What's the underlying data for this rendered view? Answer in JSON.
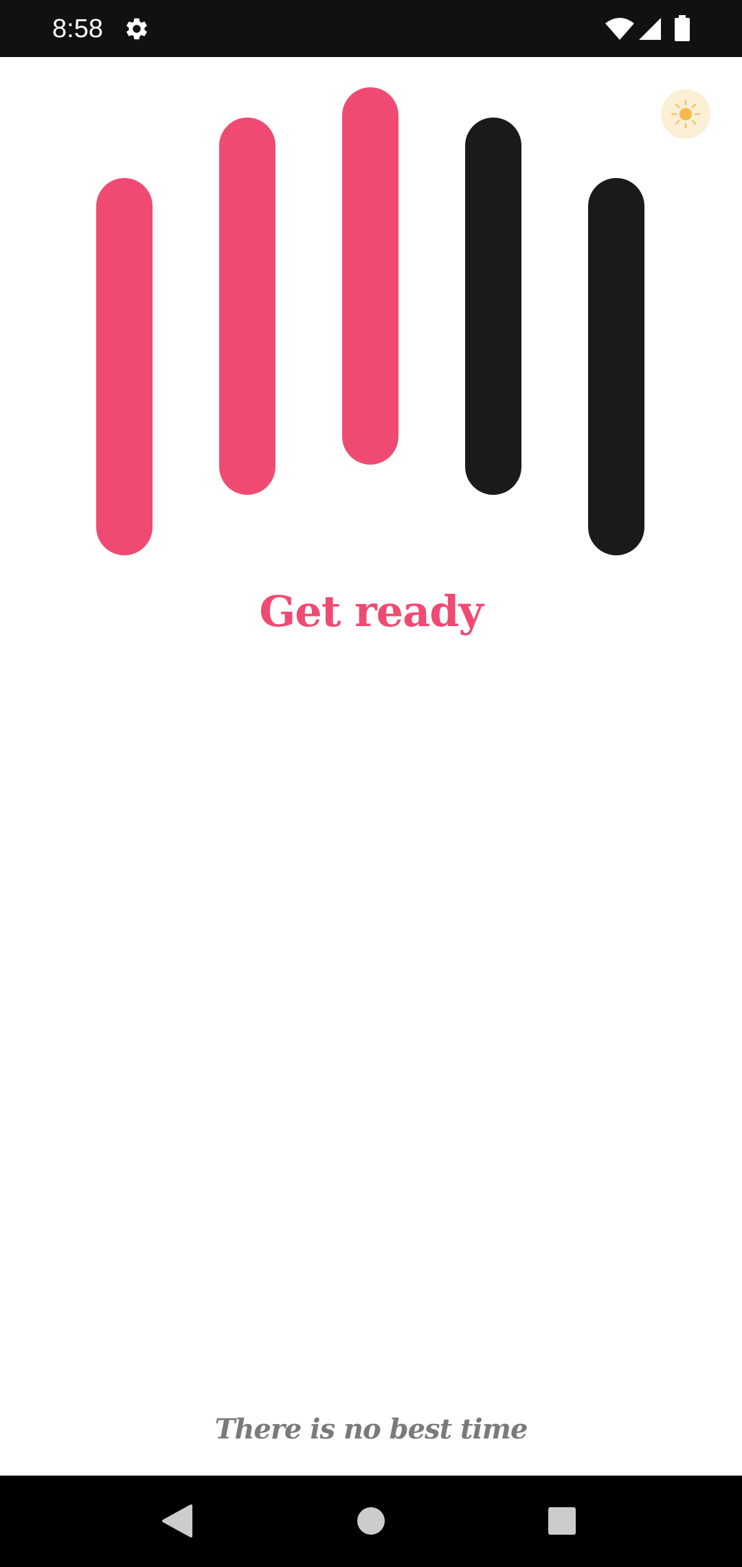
{
  "status_bar": {
    "time": "8:58",
    "icons": [
      "gear-icon",
      "wifi-icon",
      "signal-icon",
      "battery-icon"
    ]
  },
  "theme_toggle": {
    "icon": "sun-icon",
    "background": "#fbefd6",
    "icon_color": "#f6b94c"
  },
  "breathing_bars": {
    "colors": {
      "active": "#ef4b72",
      "inactive": "#1a1a1a"
    },
    "bars": [
      {
        "state": "active"
      },
      {
        "state": "active"
      },
      {
        "state": "active"
      },
      {
        "state": "inactive"
      },
      {
        "state": "inactive"
      }
    ]
  },
  "main": {
    "title": "Get ready",
    "tagline": "There is no best time"
  },
  "nav_bar": {
    "buttons": [
      "back-icon",
      "home-icon",
      "recents-icon"
    ]
  }
}
